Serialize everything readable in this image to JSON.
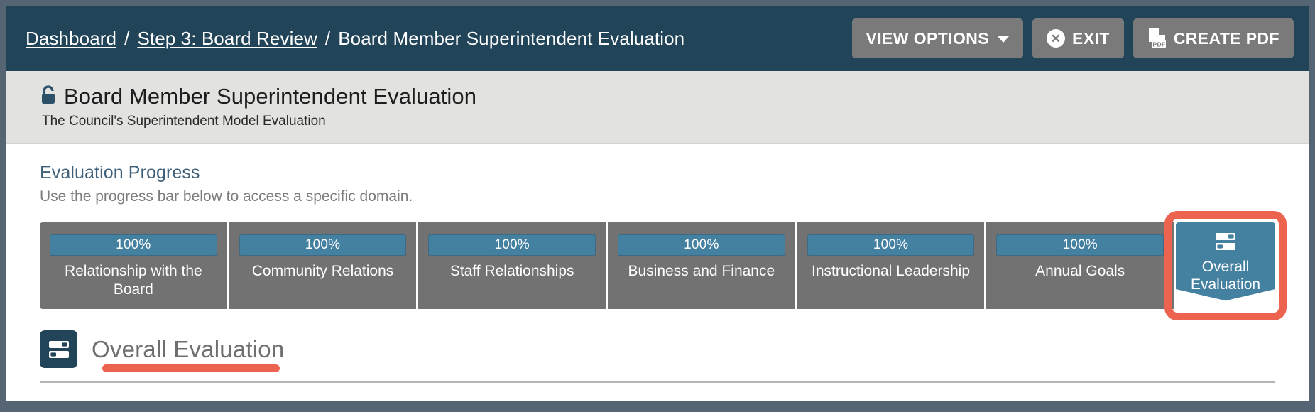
{
  "breadcrumb": {
    "items": [
      {
        "label": "Dashboard",
        "link": true
      },
      {
        "label": "Step 3: Board Review",
        "link": true
      },
      {
        "label": "Board Member Superintendent Evaluation",
        "link": false
      }
    ],
    "separator": "/"
  },
  "toolbar": {
    "view_options_label": "VIEW OPTIONS",
    "exit_label": "EXIT",
    "create_pdf_label": "CREATE PDF",
    "exit_icon": "close-circle-icon",
    "pdf_icon": "pdf-file-icon",
    "caret_icon": "chevron-down-icon"
  },
  "header": {
    "lock_icon": "lock-icon",
    "title": "Board Member Superintendent Evaluation",
    "subtitle": "The Council's Superintendent Model Evaluation"
  },
  "progress": {
    "section_title": "Evaluation Progress",
    "section_subtitle": "Use the progress bar below to access a specific domain.",
    "segments": [
      {
        "percent": "100%",
        "label": "Relationship with the Board"
      },
      {
        "percent": "100%",
        "label": "Community Relations"
      },
      {
        "percent": "100%",
        "label": "Staff Relationships"
      },
      {
        "percent": "100%",
        "label": "Business and Finance"
      },
      {
        "percent": "100%",
        "label": "Instructional Leadership"
      },
      {
        "percent": "100%",
        "label": "Annual Goals"
      }
    ],
    "active_tab": {
      "label": "Overall Evaluation",
      "icon": "list-icon",
      "highlighted": true
    }
  },
  "overall_section": {
    "icon": "list-icon",
    "title": "Overall Evaluation",
    "highlighted": true
  },
  "colors": {
    "header_navy": "#214459",
    "accent_blue": "#4480a0",
    "segment_gray": "#727272",
    "button_gray": "#7a7a7a",
    "annotation_red": "#ec6450",
    "title_band": "#e2e2e0",
    "page_backdrop": "#566573",
    "section_title_blue": "#3f6079",
    "muted_text": "#7c7c7c"
  }
}
